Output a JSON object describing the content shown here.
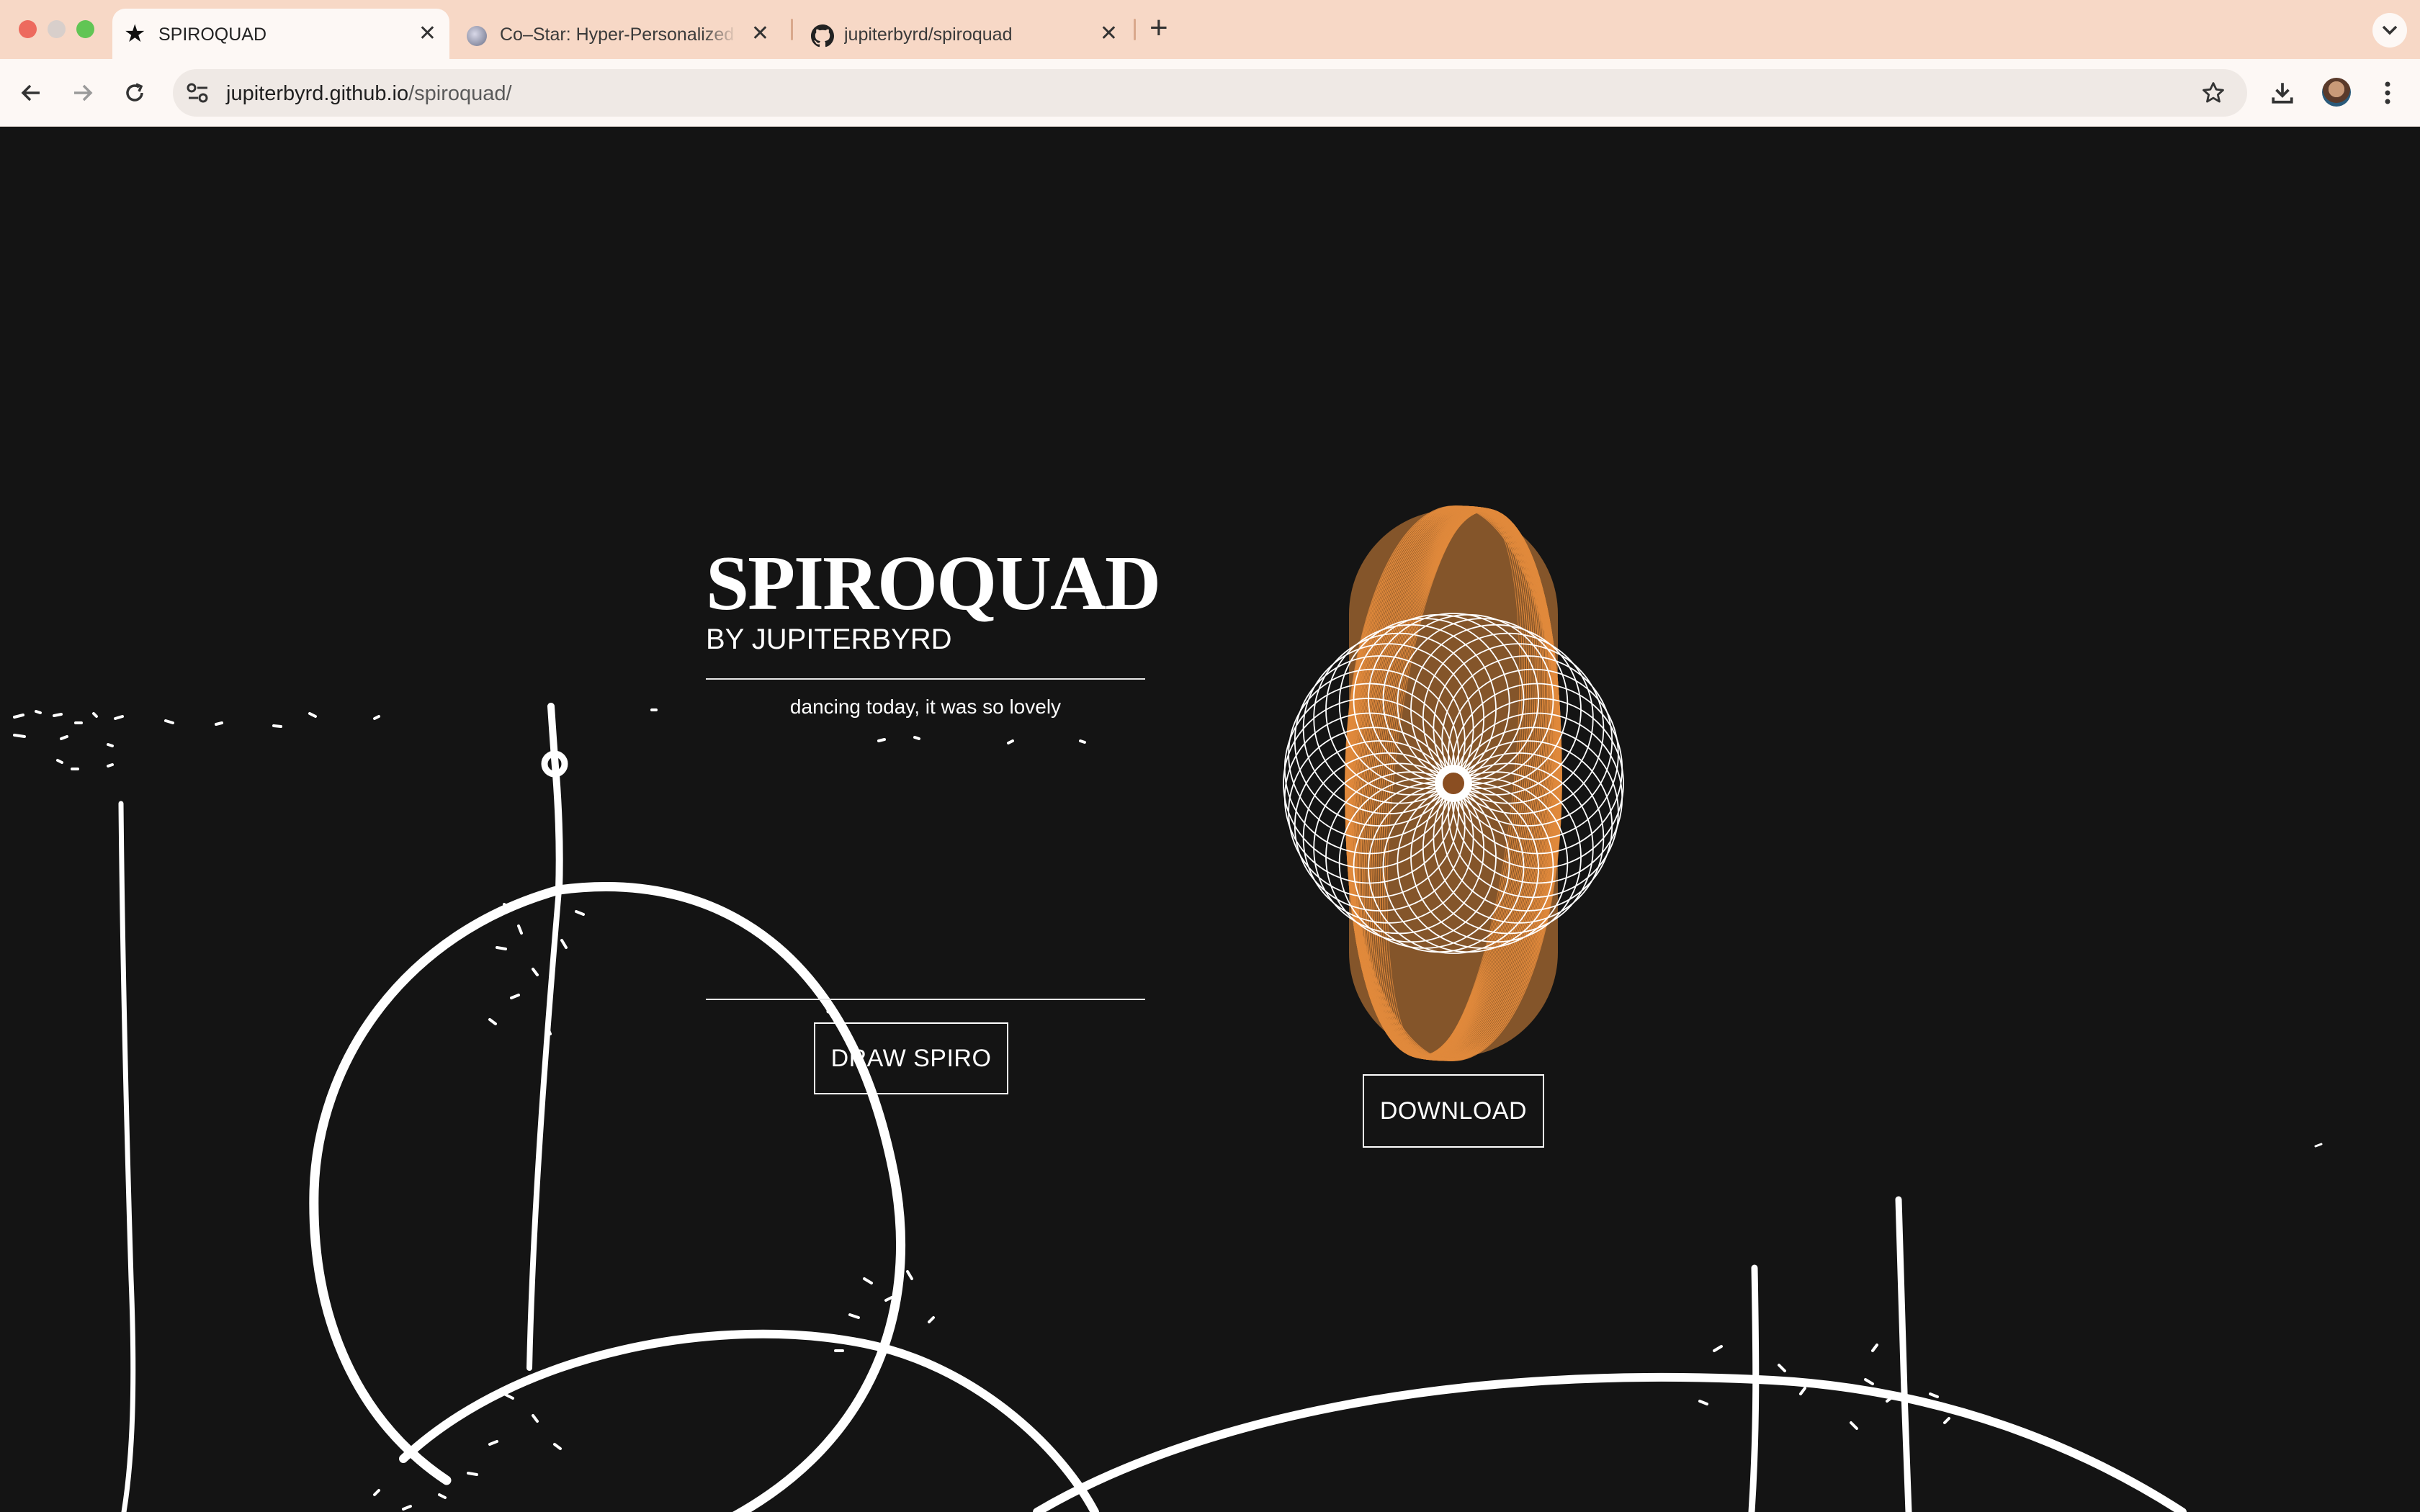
{
  "browser": {
    "tabs": [
      {
        "title": "SPIROQUAD",
        "icon": "star-icon",
        "active": true
      },
      {
        "title": "Co–Star: Hyper-Personalized",
        "icon": "costar-favicon-icon",
        "active": false
      },
      {
        "title": "jupiterbyrd/spiroquad",
        "icon": "github-icon",
        "active": false
      }
    ],
    "new_tab_label": "+",
    "url_host": "jupiterbyrd.github.io",
    "url_path": "/spiroquad/"
  },
  "page": {
    "title": "SPIROQUAD",
    "byline": "BY JUPITERBYRD",
    "tagline": "dancing today, it was so lovely",
    "draw_button": "DRAW SPIRO",
    "download_button": "DOWNLOAD"
  },
  "colors": {
    "tabstrip": "#f7d8c6",
    "background": "#141414",
    "accent": "#e08a3c",
    "foreground": "#ffffff"
  }
}
